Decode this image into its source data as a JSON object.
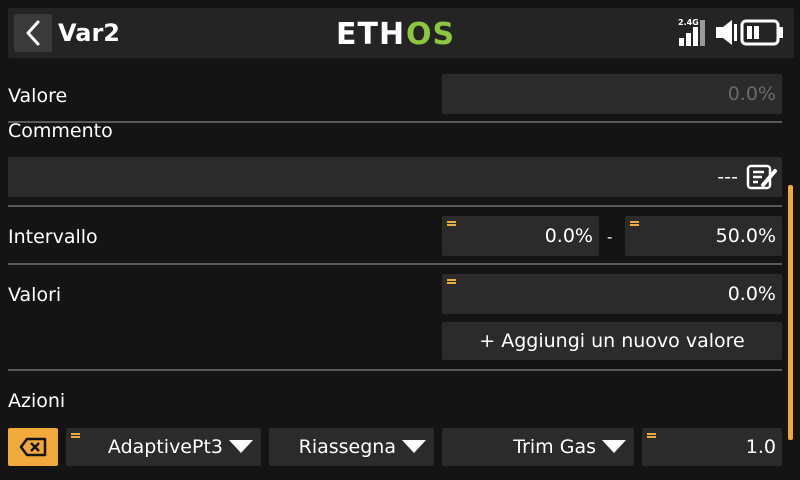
{
  "header": {
    "title": "Var2",
    "logo_text_left": "ETH",
    "logo_text_right": "OS",
    "logo_accent": "#8dc63f",
    "signal_label": "2.4G",
    "icons": [
      "back-arrow-icon",
      "signal-bars-icon",
      "speaker-icon",
      "battery-icon"
    ]
  },
  "accent_color": "#f2a93b",
  "form": {
    "valore": {
      "label": "Valore",
      "value": "0.0%"
    },
    "commento": {
      "label": "Commento",
      "value": "---"
    },
    "intervallo": {
      "label": "Intervallo",
      "min": "0.0%",
      "separator": "-",
      "max": "50.0%"
    },
    "valori": {
      "label": "Valori",
      "value": "0.0%",
      "add_label": "+ Aggiungi un nuovo valore"
    },
    "azioni": {
      "label": "Azioni",
      "source": "AdaptivePt3",
      "mode": "Riassegna",
      "target": "Trim Gas",
      "amount": "1.0"
    }
  }
}
